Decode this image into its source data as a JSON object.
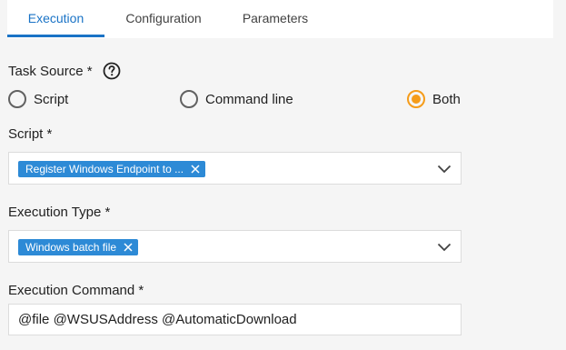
{
  "tabs": [
    {
      "label": "Execution",
      "active": true
    },
    {
      "label": "Configuration",
      "active": false
    },
    {
      "label": "Parameters",
      "active": false
    }
  ],
  "task_source": {
    "label": "Task Source *",
    "help_icon": "help-circle-icon",
    "options": [
      {
        "label": "Script",
        "checked": false
      },
      {
        "label": "Command line",
        "checked": false
      },
      {
        "label": "Both",
        "checked": true
      }
    ]
  },
  "script": {
    "label": "Script *",
    "selected_chip": "Register Windows Endpoint to ..."
  },
  "execution_type": {
    "label": "Execution Type *",
    "selected_chip": "Windows batch file"
  },
  "execution_command": {
    "label": "Execution Command *",
    "value": "@file @WSUSAddress @AutomaticDownload"
  },
  "colors": {
    "accent": "#1a73c6",
    "chip": "#2d8ad6",
    "radio_checked": "#f59c1a"
  }
}
